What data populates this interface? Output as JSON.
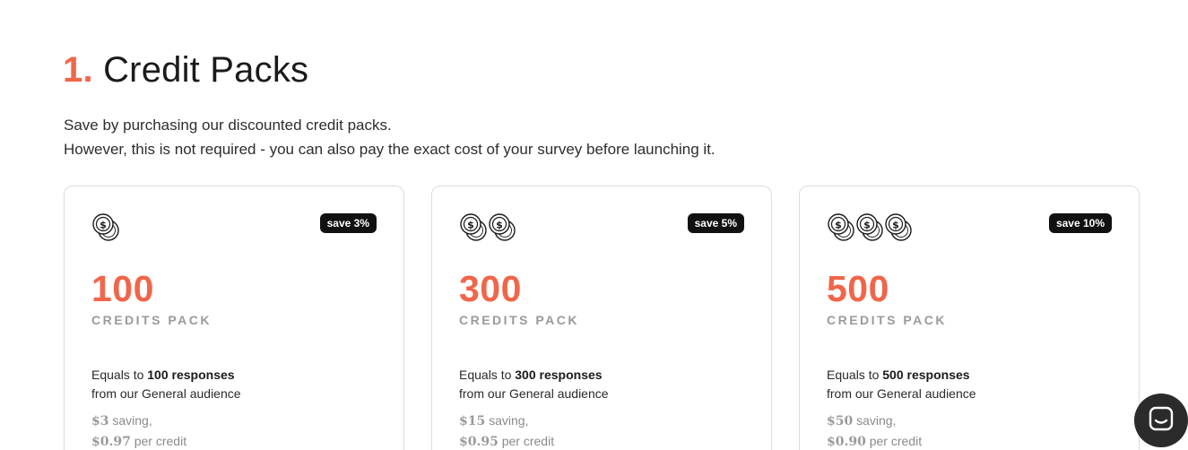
{
  "heading": {
    "number": "1.",
    "title": "Credit Packs"
  },
  "intro": {
    "line1": "Save by purchasing our discounted credit packs.",
    "line2": "However, this is not required - you can also pay the exact cost of your survey before launching it."
  },
  "cards": [
    {
      "coins": 1,
      "badge": "save 3%",
      "amount": "100",
      "pack_label": "CREDITS PACK",
      "equals_prefix": "Equals to",
      "equals_bold": "100 responses",
      "equals_suffix": "from our General audience",
      "saving_amount": "$3",
      "saving_text": "saving,",
      "per_credit_amount": "$0.97",
      "per_credit_text": "per credit"
    },
    {
      "coins": 2,
      "badge": "save 5%",
      "amount": "300",
      "pack_label": "CREDITS PACK",
      "equals_prefix": "Equals to",
      "equals_bold": "300 responses",
      "equals_suffix": "from our General audience",
      "saving_amount": "$15",
      "saving_text": "saving,",
      "per_credit_amount": "$0.95",
      "per_credit_text": "per credit"
    },
    {
      "coins": 3,
      "badge": "save 10%",
      "amount": "500",
      "pack_label": "CREDITS PACK",
      "equals_prefix": "Equals to",
      "equals_bold": "500 responses",
      "equals_suffix": "from our General audience",
      "saving_amount": "$50",
      "saving_text": "saving,",
      "per_credit_amount": "$0.90",
      "per_credit_text": "per credit"
    }
  ],
  "icons": {
    "coin": "dollar-coin-icon",
    "chat": "chat-bubble-icon"
  },
  "colors": {
    "accent": "#f0664a",
    "badge_bg": "#111111",
    "chat_bg": "#2b2b2b"
  }
}
